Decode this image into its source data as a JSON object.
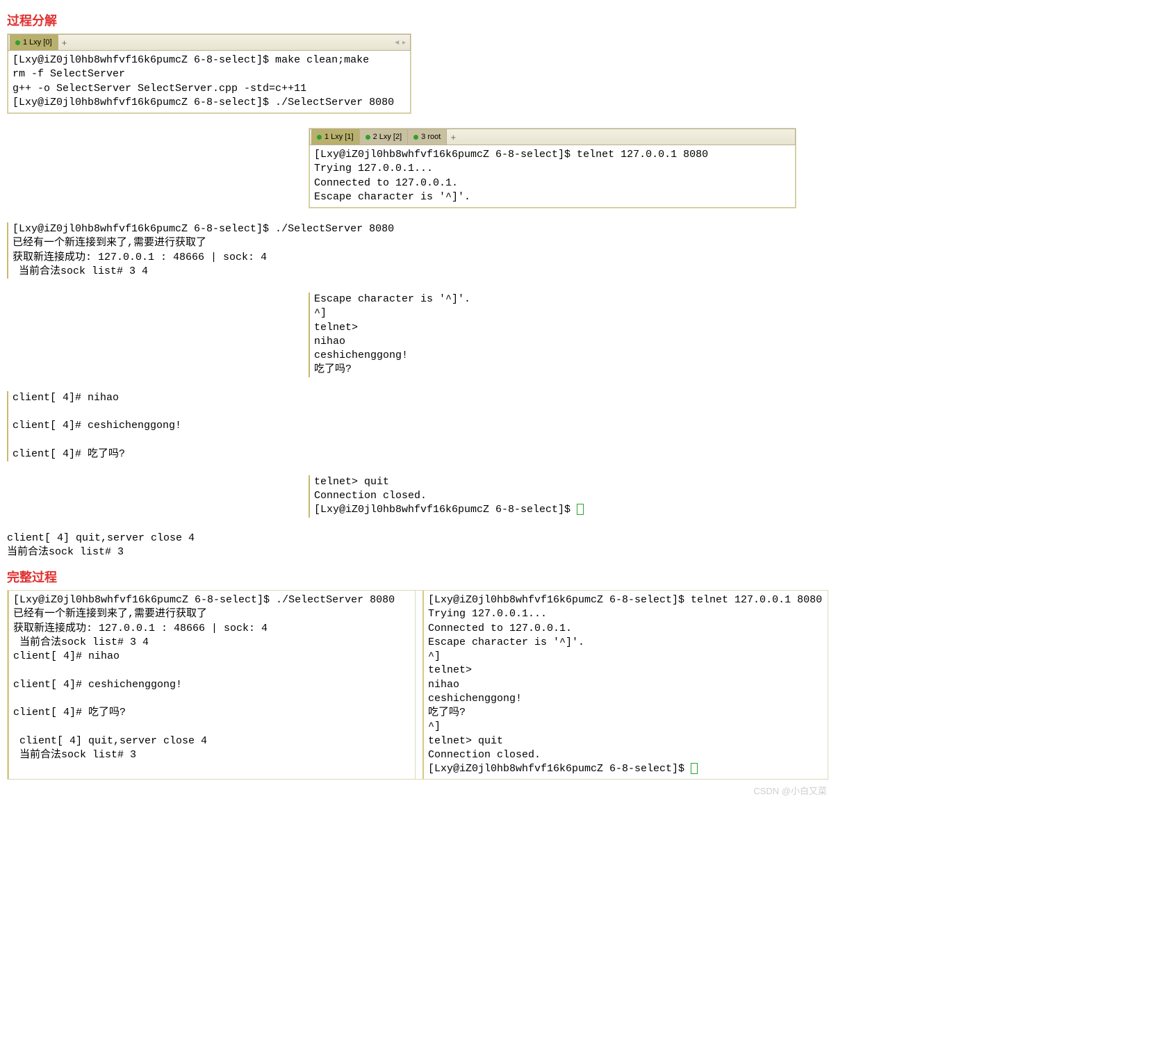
{
  "heading1": "过程分解",
  "heading2": "完整过程",
  "tabs1": {
    "t0": "1 Lxy [0]"
  },
  "tabs2": {
    "t0": "1 Lxy [1]",
    "t1": "2 Lxy [2]",
    "t2": "3 root"
  },
  "panel1": "[Lxy@iZ0jl0hb8whfvf16k6pumcZ 6-8-select]$ make clean;make\nrm -f SelectServer\ng++ -o SelectServer SelectServer.cpp -std=c++11\n[Lxy@iZ0jl0hb8whfvf16k6pumcZ 6-8-select]$ ./SelectServer 8080",
  "panel2": "[Lxy@iZ0jl0hb8whfvf16k6pumcZ 6-8-select]$ telnet 127.0.0.1 8080\nTrying 127.0.0.1...\nConnected to 127.0.0.1.\nEscape character is '^]'.",
  "panel3": "[Lxy@iZ0jl0hb8whfvf16k6pumcZ 6-8-select]$ ./SelectServer 8080\n已经有一个新连接到来了,需要进行获取了\n获取新连接成功: 127.0.0.1 : 48666 | sock: 4\n 当前合法sock list# 3 4",
  "panel4": "Escape character is '^]'.\n^]\ntelnet>\nnihao\nceshichenggong!\n吃了吗?",
  "panel5": "client[ 4]# nihao\n\nclient[ 4]# ceshichenggong!\n\nclient[ 4]# 吃了吗?",
  "panel6": "telnet> quit\nConnection closed.\n[Lxy@iZ0jl0hb8whfvf16k6pumcZ 6-8-select]$ ",
  "panel7": "client[ 4] quit,server close 4\n当前合法sock list# 3",
  "full_left": "[Lxy@iZ0jl0hb8whfvf16k6pumcZ 6-8-select]$ ./SelectServer 8080\n已经有一个新连接到来了,需要进行获取了\n获取新连接成功: 127.0.0.1 : 48666 | sock: 4\n 当前合法sock list# 3 4\nclient[ 4]# nihao\n\nclient[ 4]# ceshichenggong!\n\nclient[ 4]# 吃了吗?\n\n client[ 4] quit,server close 4\n 当前合法sock list# 3",
  "full_right": "[Lxy@iZ0jl0hb8whfvf16k6pumcZ 6-8-select]$ telnet 127.0.0.1 8080\nTrying 127.0.0.1...\nConnected to 127.0.0.1.\nEscape character is '^]'.\n^]\ntelnet>\nnihao\nceshichenggong!\n吃了吗?\n^]\ntelnet> quit\nConnection closed.\n[Lxy@iZ0jl0hb8whfvf16k6pumcZ 6-8-select]$ ",
  "watermark": "CSDN @小白又菜"
}
